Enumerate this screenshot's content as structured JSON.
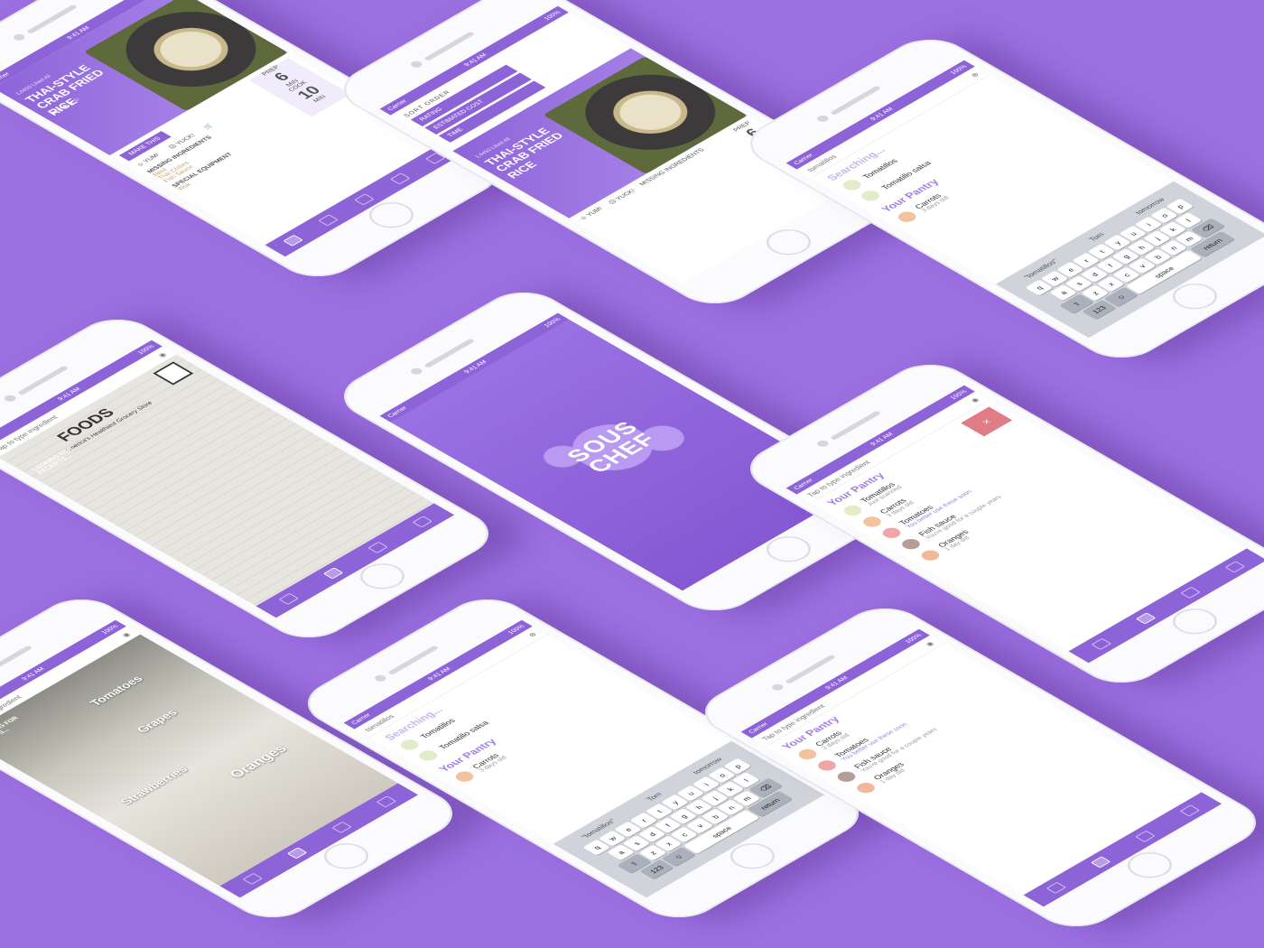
{
  "status": {
    "carrier": "Carrier",
    "time": "9:41 AM",
    "battery": "100%"
  },
  "colors": {
    "background": "#9b6fe0",
    "accent": "#8d64d8",
    "accent_light": "#a27be6"
  },
  "recipe": {
    "subtitle": "1,6450 Liked All",
    "title": "THAI-STYLE CRAB FRIED RICE",
    "stars": "★★★★☆",
    "make_this": "MAKE THIS",
    "yum": "YUM!",
    "yuck": "YUCK!",
    "prep_label": "PREP",
    "prep_value": "6",
    "cook_label": "COOK",
    "cook_value": "10",
    "min": "MIN",
    "missing": "MISSING INGREDIENTS",
    "missing_items": [
      "Basil",
      "Thai Chilies",
      "Fish Sauce"
    ],
    "equipment": "SPECIAL EQUIPMENT",
    "equipment_items": [
      "Wok"
    ]
  },
  "sort": {
    "title": "SORT ORDER",
    "options": [
      "RATING",
      "ESTIMATED COST",
      "TIME"
    ]
  },
  "search": {
    "query": "tomatillos",
    "placeholder": "Tap to type ingredient",
    "searching": "Searching...",
    "results": [
      "Tomatillos",
      "Tomatillo salsa"
    ]
  },
  "pantry": {
    "title": "Your Pantry",
    "items": [
      {
        "name": "Tomatillos",
        "sub": "Just scanned"
      },
      {
        "name": "Carrots",
        "sub": "3 days old"
      },
      {
        "name": "Tomatoes",
        "sub": "You better use these soon"
      },
      {
        "name": "Fish sauce",
        "sub": "You're good for a couple years"
      },
      {
        "name": "Oranges",
        "sub": "1 day old"
      }
    ]
  },
  "keyboard": {
    "suggestions": [
      "\"tomatillos\"",
      "Tom",
      "tomorrow"
    ],
    "row1": [
      "q",
      "w",
      "e",
      "r",
      "t",
      "y",
      "u",
      "i",
      "o",
      "p"
    ],
    "row2": [
      "a",
      "s",
      "d",
      "f",
      "g",
      "h",
      "j",
      "k",
      "l"
    ],
    "row3": [
      "z",
      "x",
      "c",
      "v",
      "b",
      "n",
      "m"
    ],
    "num": "123",
    "space": "space",
    "return": "return"
  },
  "receipt": {
    "store": "FOODS",
    "tagline": "America's Healthiest Grocery Store",
    "overlay": "LOOKING FOR RECEIPTS..."
  },
  "fridge": {
    "overlay": "LOOKING FOR FOODS...",
    "tags": [
      "Tomatoes",
      "Grapes",
      "Strawberries",
      "Oranges"
    ]
  },
  "splash": {
    "logo_line1": "SOUS",
    "logo_line2": "CHEF"
  },
  "delete_label": "×"
}
